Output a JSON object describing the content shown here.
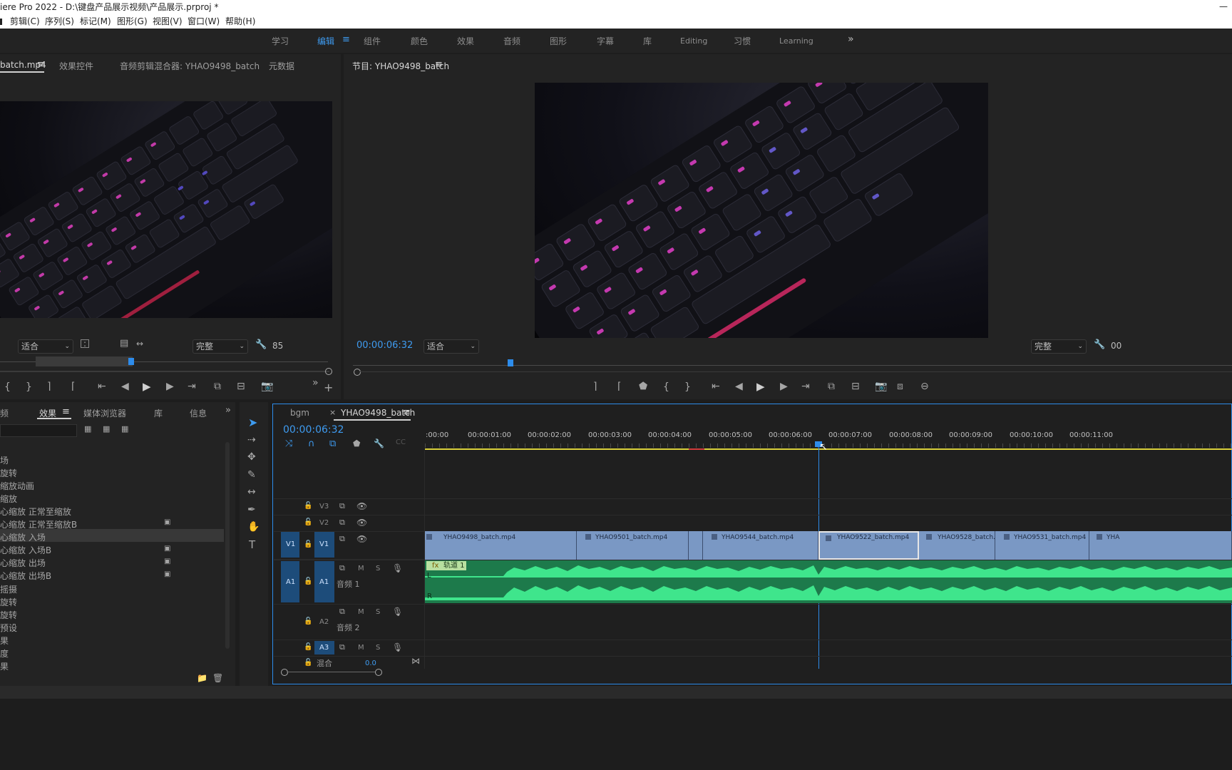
{
  "title_bar": {
    "title": "iere Pro 2022 - D:\\键盘产品展示视频\\产品展示.prproj *",
    "minimize": "—"
  },
  "menu": [
    "剪辑(C)",
    "序列(S)",
    "标记(M)",
    "图形(G)",
    "视图(V)",
    "窗口(W)",
    "帮助(H)"
  ],
  "workspaces": {
    "items": [
      "学习",
      "编辑",
      "组件",
      "颜色",
      "效果",
      "音频",
      "图形",
      "字幕",
      "库",
      "Editing",
      "习惯",
      "Learning"
    ],
    "active": "编辑",
    "menu_icon": "≡",
    "more": "»"
  },
  "source_panel": {
    "tabs": [
      "batch.mp4",
      "效果控件",
      "音频剪辑混合器: YHAO9498_batch",
      "元数据"
    ],
    "fit": "适合",
    "quality": "完整",
    "value": "85"
  },
  "program_panel": {
    "title": "节目: YHAO9498_batch",
    "timecode": "00:00:06:32",
    "fit": "适合",
    "quality": "完整",
    "right_cut": "00"
  },
  "effects_panel": {
    "tabs": [
      "频",
      "效果",
      "媒体浏览器",
      "库",
      "信息"
    ],
    "items": [
      "场",
      "旋转",
      "缩放动画",
      "缩放",
      "心缩放 正常至缩放",
      "心缩放 正常至缩放B",
      "心缩放 入场",
      "心缩放 入场B",
      "心缩放 出场",
      "心缩放 出场B",
      "摇摄",
      "旋转",
      "旋转",
      "预设",
      "果",
      "度",
      "果"
    ],
    "selected_index": 6,
    "badge_indices": [
      5,
      7,
      8,
      9
    ]
  },
  "timeline": {
    "tabs": [
      "bgm",
      "YHAO9498_batch"
    ],
    "timecode": "00:00:06:32",
    "ruler": [
      ":00:00",
      "00:00:01:00",
      "00:00:02:00",
      "00:00:03:00",
      "00:00:04:00",
      "00:00:05:00",
      "00:00:06:00",
      "00:00:07:00",
      "00:00:08:00",
      "00:00:09:00",
      "00:00:10:00",
      "00:00:11:00"
    ],
    "tracks": {
      "v3": "V3",
      "v2": "V2",
      "v1": "V1",
      "v1_src": "V1",
      "a1": "A1",
      "a1_src": "A1",
      "a1_name": "音频 1",
      "a2": "A2",
      "a2_name": "音频 2",
      "a3": "A3",
      "mix": "混合",
      "mix_val": "0.0",
      "m": "M",
      "s": "S"
    },
    "clips": [
      "YHAO9498_batch.mp4",
      "YHAO9501_batch.mp4",
      "YHAO9544_batch.mp4",
      "YHAO9522_batch.mp4",
      "YHAO9528_batch.m",
      "YHAO9531_batch.mp4",
      "YHA"
    ],
    "audio_clip": {
      "label": "轨道 1",
      "fx": "fx",
      "L": "L",
      "R": "R"
    }
  },
  "colors": {
    "accent": "#2d8ceb",
    "timecode": "#3e9bf0",
    "video_clip": "#7a98c4",
    "audio_clip": "#1e8c56",
    "waveform": "#3fe58c"
  }
}
